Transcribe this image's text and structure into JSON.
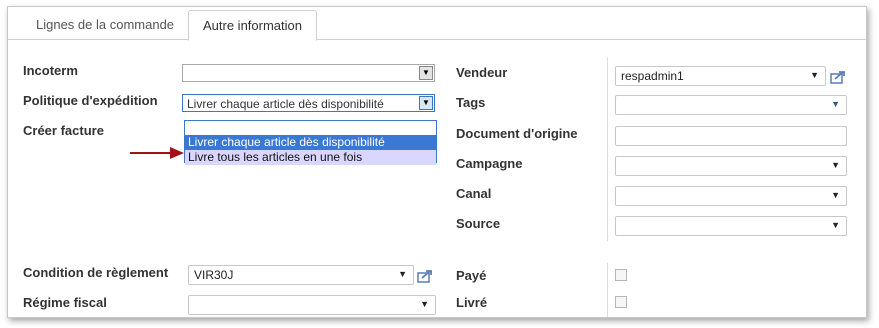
{
  "tabs": [
    {
      "label": "Lignes de la commande"
    },
    {
      "label": "Autre information"
    }
  ],
  "left": {
    "incoterm_label": "Incoterm",
    "incoterm_value": "",
    "shipping_policy_label": "Politique d'expédition",
    "shipping_policy_value": "Livrer chaque article dès disponibilité",
    "shipping_policy_options": [
      "Livrer chaque article dès disponibilité",
      "Livre tous les articles en une fois"
    ],
    "create_invoice_label": "Créer facture",
    "payment_term_label": "Condition de règlement",
    "payment_term_value": "VIR30J",
    "fiscal_position_label": "Régime fiscal",
    "fiscal_position_value": ""
  },
  "right": {
    "salesman_label": "Vendeur",
    "salesman_value": "respadmin1",
    "tags_label": "Tags",
    "origin_label": "Document d'origine",
    "origin_value": "",
    "campaign_label": "Campagne",
    "channel_label": "Canal",
    "source_label": "Source",
    "paid_label": "Payé",
    "delivered_label": "Livré"
  },
  "colors": {
    "dropdown_highlight": "#3a78d6",
    "dropdown_hover": "#d9d7ff",
    "arrow": "#a0121a"
  },
  "icons": [
    "dropdown-arrow-icon",
    "external-link-icon",
    "pointer-arrow-icon"
  ]
}
